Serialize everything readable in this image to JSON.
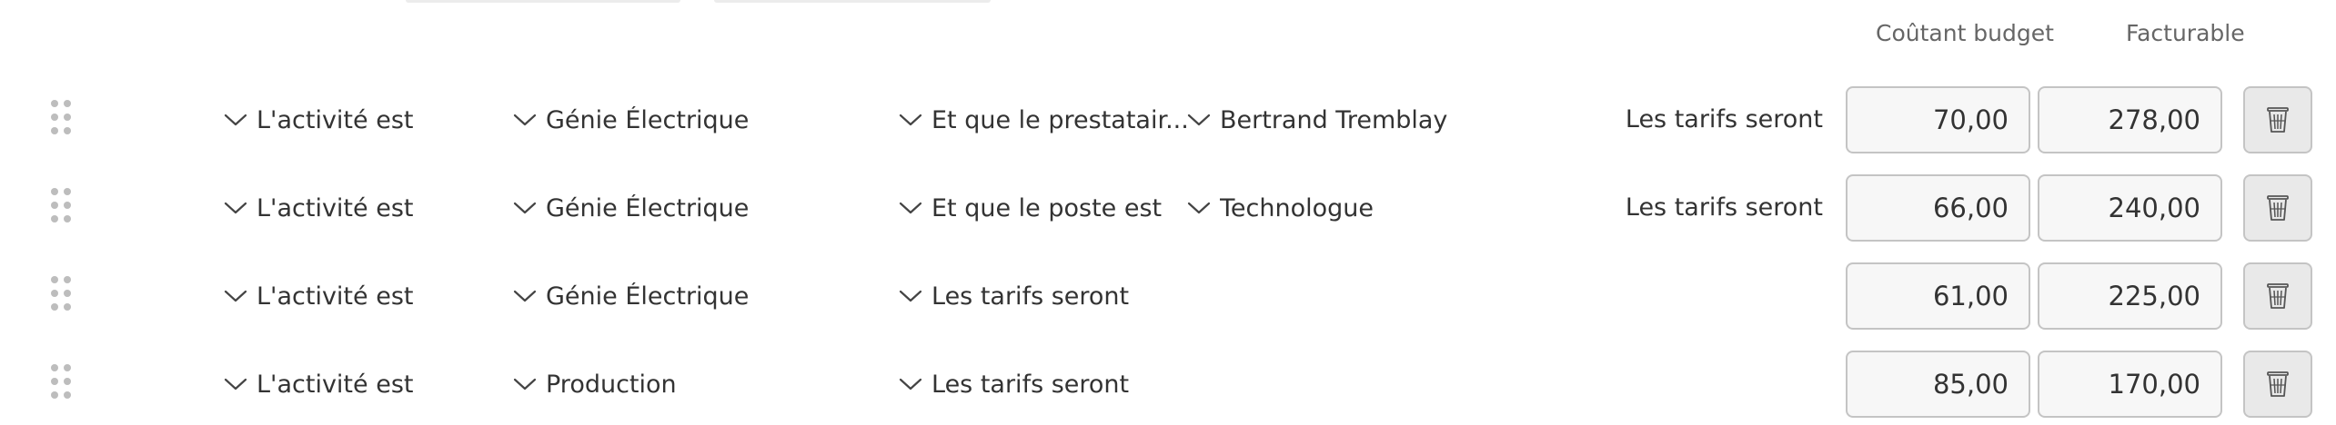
{
  "columns": {
    "cost_budget": "Coûtant budget",
    "billable": "Facturable"
  },
  "rows": [
    {
      "activity": "L'activité est",
      "department": "Génie Électrique",
      "condition": "Et que le prestatair...",
      "value": "Bertrand Tremblay",
      "rates_label": "Les tarifs seront",
      "cost": "70,00",
      "billable": "278,00"
    },
    {
      "activity": "L'activité est",
      "department": "Génie Électrique",
      "condition": "Et que le poste est",
      "value": "Technologue",
      "rates_label": "Les tarifs seront",
      "cost": "66,00",
      "billable": "240,00"
    },
    {
      "activity": "L'activité est",
      "department": "Génie Électrique",
      "condition": "Les tarifs seront",
      "cost": "61,00",
      "billable": "225,00"
    },
    {
      "activity": "L'activité est",
      "department": "Production",
      "condition": "Les tarifs seront",
      "cost": "85,00",
      "billable": "170,00"
    }
  ],
  "icons": {
    "drag": "drag-handle-icon",
    "dropdown": "chevron-down-icon",
    "delete": "trash-icon"
  },
  "colors": {
    "text": "#333333",
    "muted": "#666666",
    "input_border": "#c4c4c4",
    "input_bg": "#f7f7f7",
    "delete_bg": "#e9e9e9"
  }
}
